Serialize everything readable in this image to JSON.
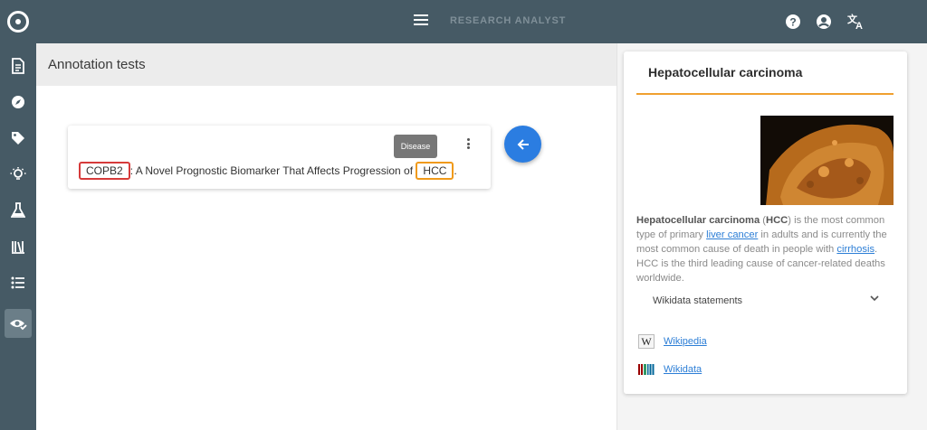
{
  "header": {
    "app_title": "RESEARCH ANALYST",
    "icons": [
      "logo-icon",
      "menu-icon",
      "help-icon",
      "account-icon",
      "translate-icon"
    ]
  },
  "sidebar": {
    "items": [
      {
        "icon": "document-icon"
      },
      {
        "icon": "compass-icon"
      },
      {
        "icon": "tag-icon"
      },
      {
        "icon": "lightbulb-icon"
      },
      {
        "icon": "flask-icon"
      },
      {
        "icon": "library-icon"
      },
      {
        "icon": "list-icon"
      },
      {
        "icon": "eye-check-icon",
        "active": true
      }
    ]
  },
  "page": {
    "title": "Annotation tests"
  },
  "annotation": {
    "entity1": "COPB2",
    "text_middle": ": A Novel Prognostic Biomarker That Affects Progression of ",
    "entity2": "HCC",
    "text_end": ".",
    "tooltip": "Disease",
    "entity1_color": "#d63a3a",
    "entity2_color": "#f09a1a"
  },
  "fab": {
    "icon": "arrow-left-icon",
    "color": "#2b7de1"
  },
  "info_panel": {
    "title": "Hepatocellular carcinoma",
    "description": {
      "term": "Hepatocellular carcinoma",
      "abbr_open": " (",
      "abbr": "HCC",
      "part1": ") is the most common type of primary ",
      "link1": "liver cancer",
      "part2": " in adults and is currently the most common cause of death in people with ",
      "link2": "cirrhosis",
      "part3": ". HCC is the third leading cause of cancer-related deaths worldwide."
    },
    "wikidata_statements": "Wikidata statements",
    "links": [
      {
        "icon": "wikipedia-icon",
        "label": "Wikipedia"
      },
      {
        "icon": "wikidata-icon",
        "label": "Wikidata"
      }
    ],
    "accent_color": "#f0a030"
  }
}
